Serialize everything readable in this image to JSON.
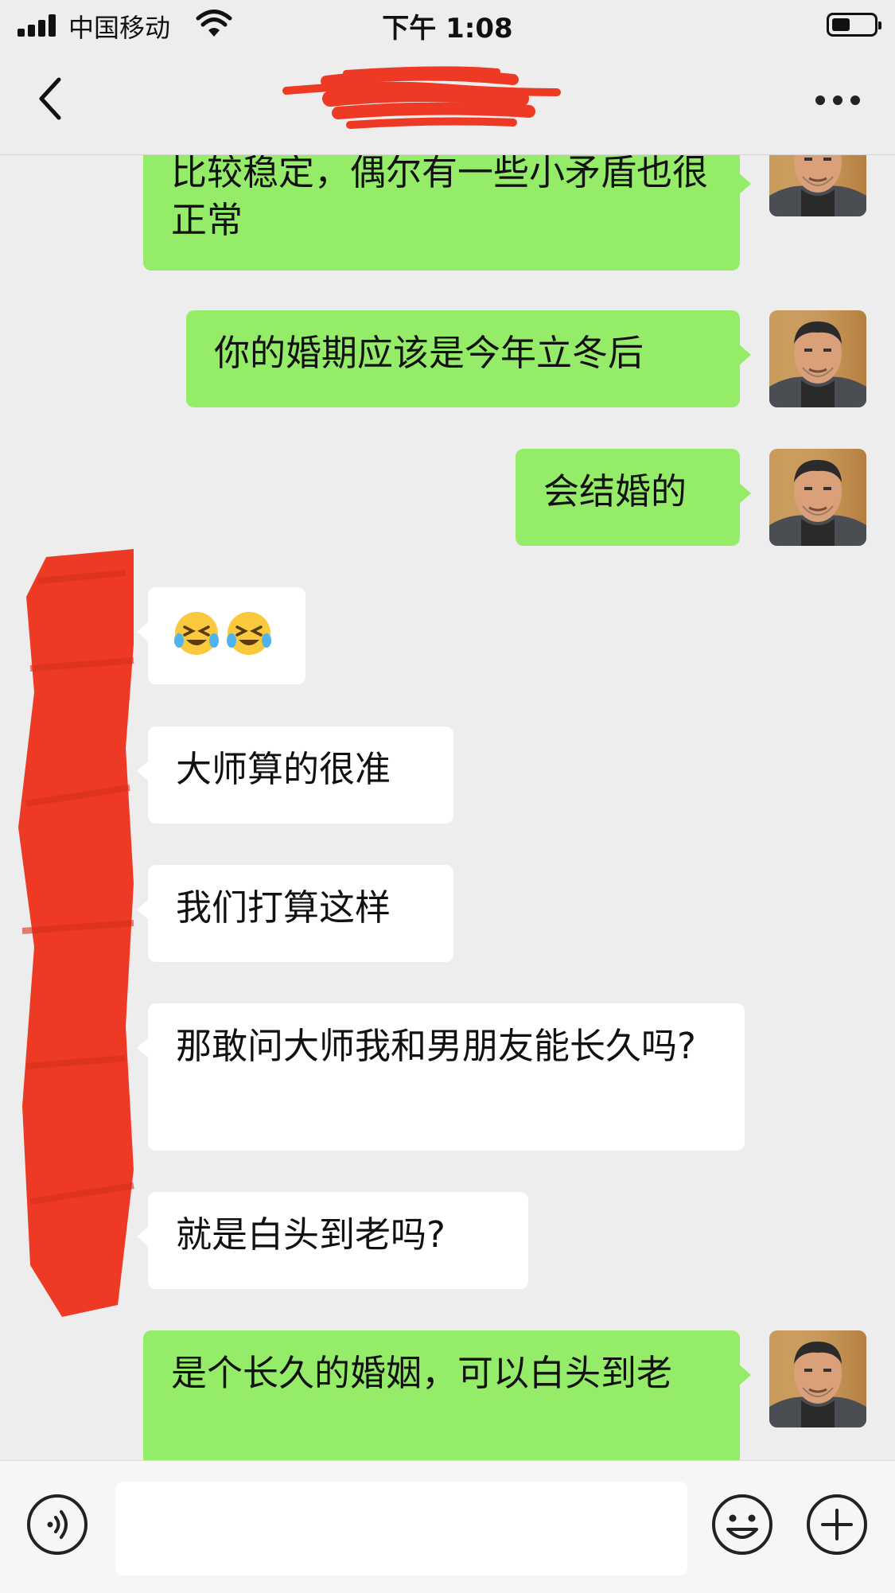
{
  "status_bar": {
    "carrier": "中国移动",
    "time": "下午 1:08"
  },
  "nav": {
    "back_icon": "chevron-left-icon",
    "more_icon": "ellipsis-icon"
  },
  "messages": [
    {
      "side": "out",
      "text": "比较稳定，偶尔有一些小矛盾也很正常"
    },
    {
      "side": "out",
      "text": "你的婚期应该是今年立冬后"
    },
    {
      "side": "out",
      "text": "会结婚的"
    },
    {
      "side": "in",
      "text": "😆😆",
      "emoji": "crying-laughing-emoji"
    },
    {
      "side": "in",
      "text": "大师算的很准"
    },
    {
      "side": "in",
      "text": "我们打算这样"
    },
    {
      "side": "in",
      "text": "那敢问大师我和男朋友能长久吗?"
    },
    {
      "side": "in",
      "text": "就是白头到老吗?"
    },
    {
      "side": "out",
      "text": "是个长久的婚姻，可以白头到老"
    }
  ],
  "input_bar": {
    "voice_icon": "voice-icon",
    "emoji_icon": "smiley-icon",
    "plus_icon": "plus-icon",
    "input_value": ""
  },
  "colors": {
    "outgoing_bubble": "#95ec69",
    "incoming_bubble": "#ffffff",
    "background": "#ededed",
    "redaction": "#ee3a25"
  }
}
